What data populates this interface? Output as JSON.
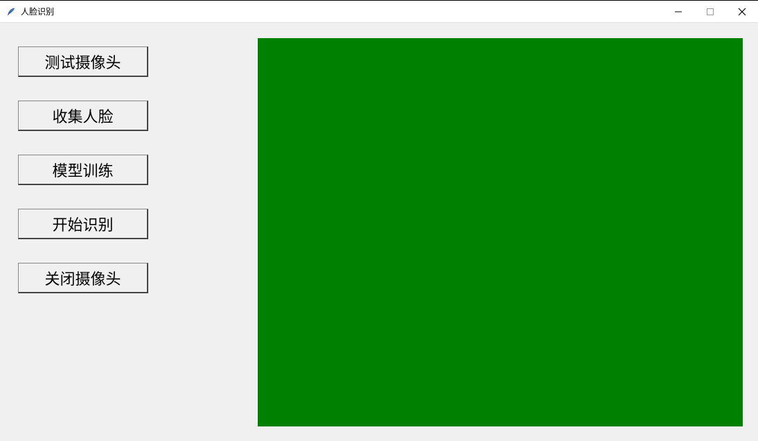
{
  "window": {
    "title": "人脸识别"
  },
  "buttons": {
    "test_camera": "测试摄像头",
    "collect_face": "收集人脸",
    "train_model": "模型训练",
    "start_recognition": "开始识别",
    "close_camera": "关闭摄像头"
  },
  "canvas": {
    "background_color": "#008000"
  }
}
